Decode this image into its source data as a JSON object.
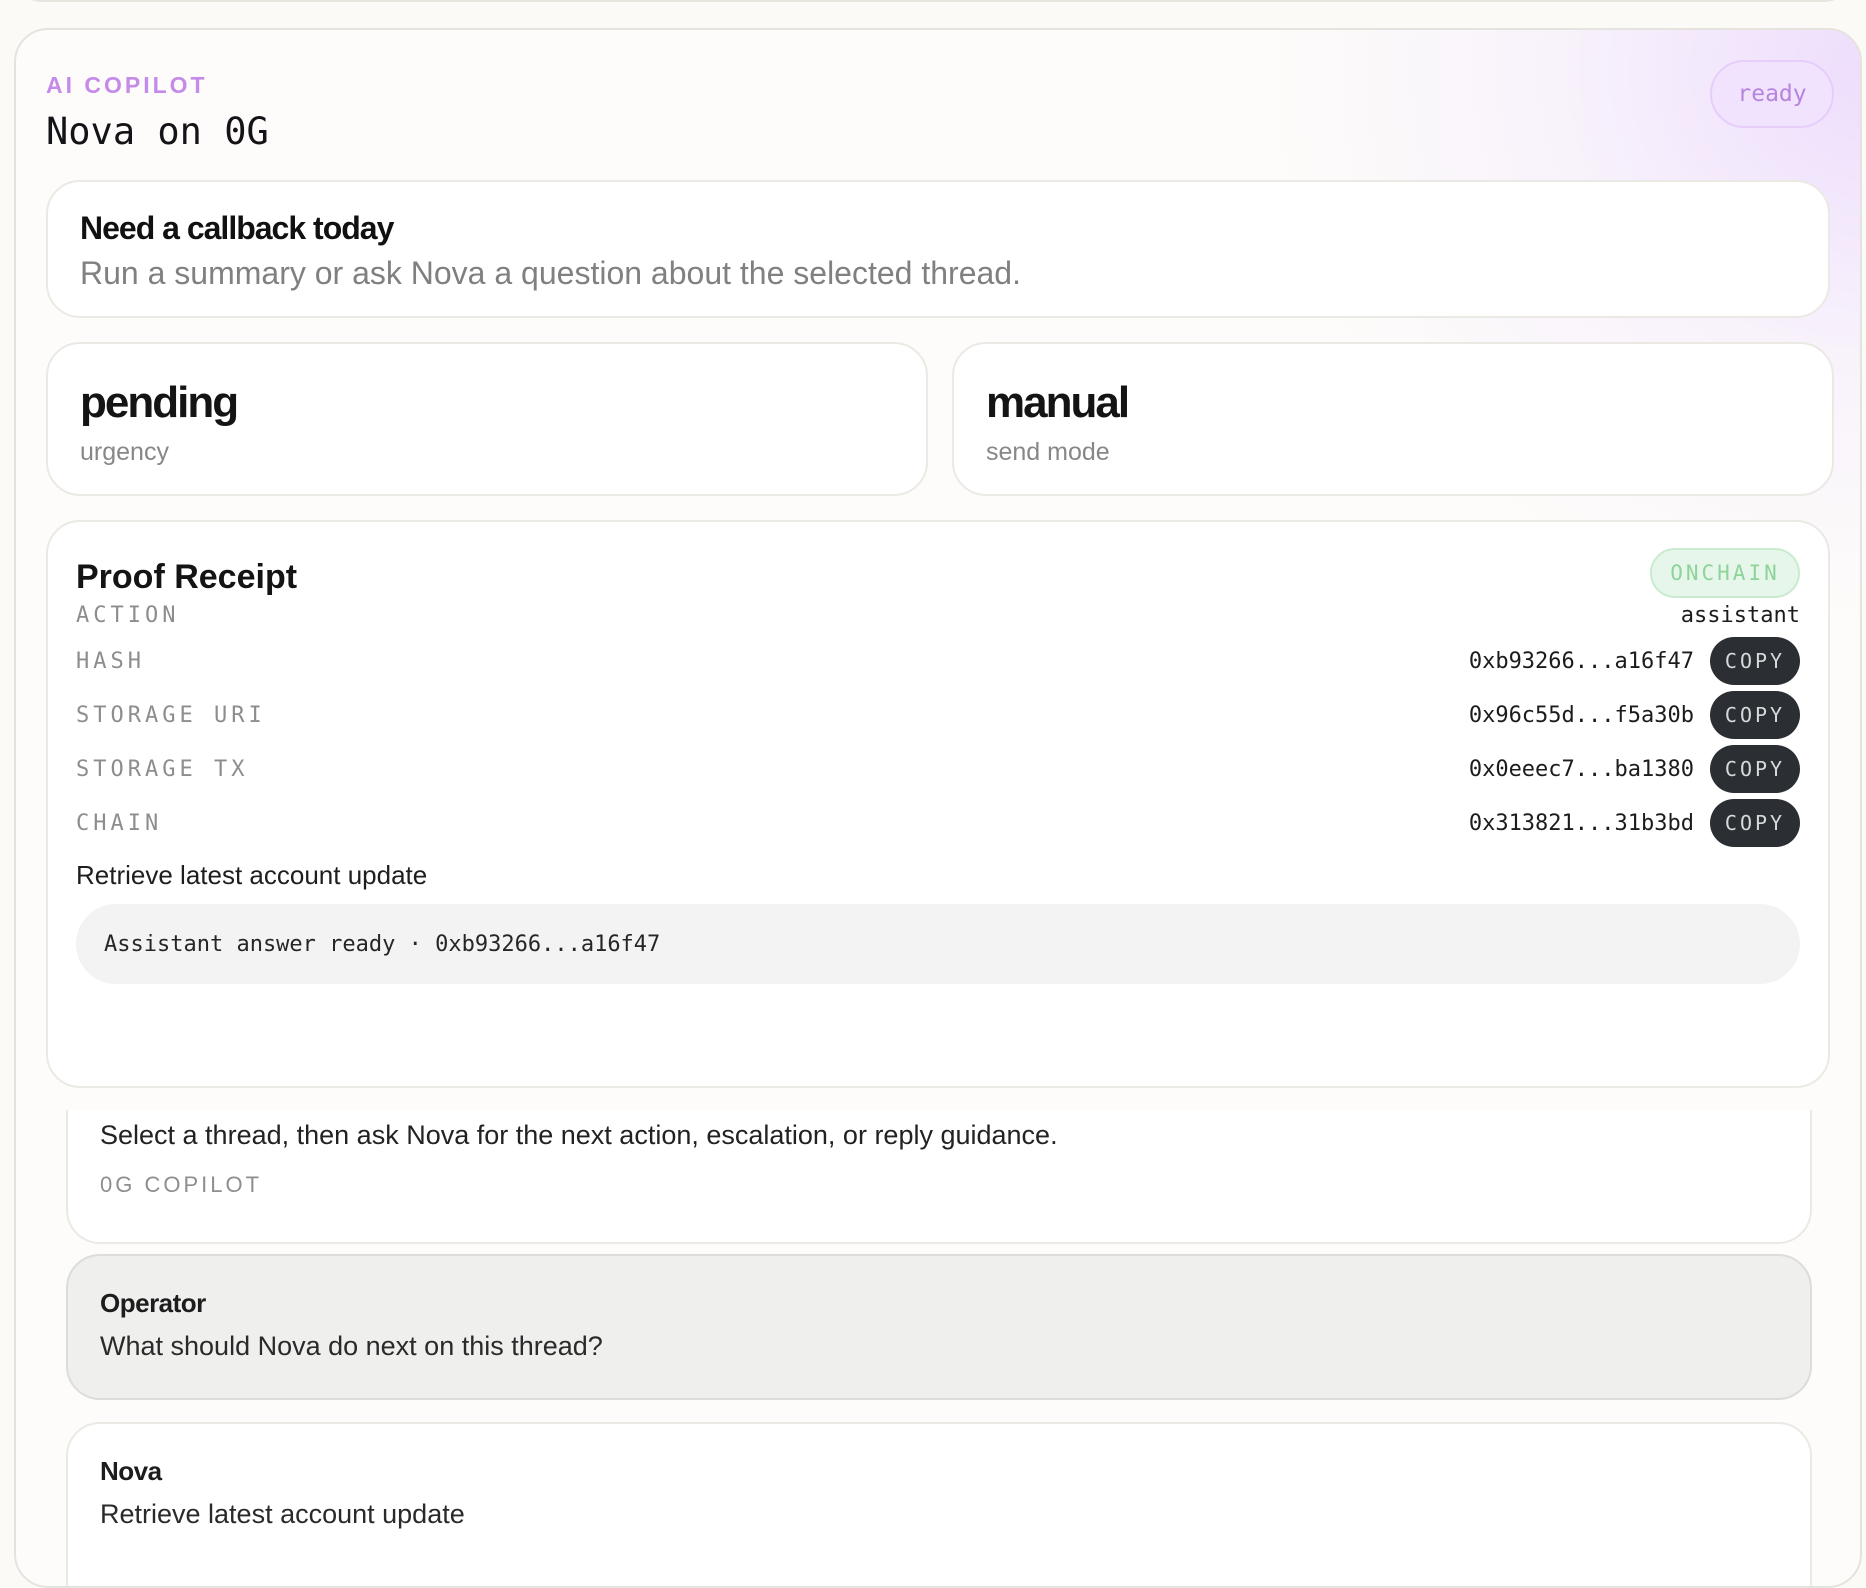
{
  "panel": {
    "eyebrow": "AI COPILOT",
    "title": "Nova on 0G",
    "status": "ready"
  },
  "callout": {
    "title": "Need a callback today",
    "subtitle": "Run a summary or ask Nova a question about the selected thread."
  },
  "stats": [
    {
      "value": "pending",
      "label": "urgency"
    },
    {
      "value": "manual",
      "label": "send mode"
    }
  ],
  "receipt": {
    "title": "Proof Receipt",
    "badge": "ONCHAIN",
    "rows": [
      {
        "label": "ACTION",
        "value": "assistant"
      },
      {
        "label": "HASH",
        "value": "0xb93266...a16f47",
        "button": "COPY"
      },
      {
        "label": "STORAGE URI",
        "value": "0x96c55d...f5a30b",
        "button": "COPY"
      },
      {
        "label": "STORAGE TX",
        "value": "0x0eeec7...ba1380",
        "button": "COPY"
      },
      {
        "label": "CHAIN",
        "value": "0x313821...31b3bd",
        "button": "COPY"
      }
    ],
    "note": "Retrieve latest account update",
    "status_line": "Assistant answer ready · 0xb93266...a16f47"
  },
  "conversation": {
    "intro": "Select a thread, then ask Nova for the next action, escalation, or reply guidance.",
    "intro_tag": "0G COPILOT",
    "messages": [
      {
        "author": "Operator",
        "body": "What should Nova do next on this thread?"
      },
      {
        "author": "Nova",
        "body": "Retrieve latest account update"
      }
    ]
  },
  "colors": {
    "accent": "#c58be8",
    "ready_pill_bg": "#f1e2fd",
    "onchain_green": "#8dd39a",
    "copy_button": "#2b2e33"
  }
}
